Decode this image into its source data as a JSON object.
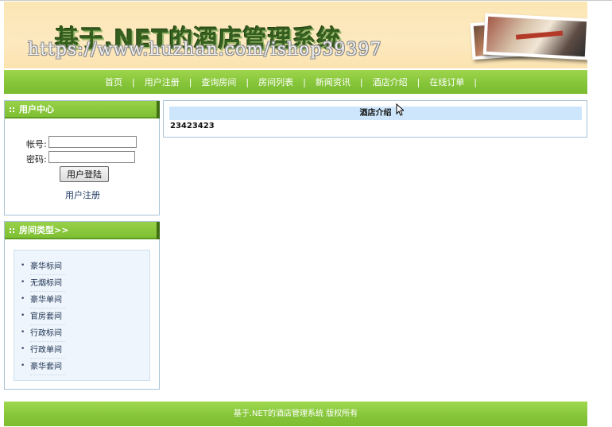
{
  "header": {
    "title": "基于.NET的酒店管理系统",
    "watermark": "https://www.huzhan.com/ishop39397"
  },
  "nav": {
    "items": [
      {
        "label": "首页"
      },
      {
        "label": "用户注册"
      },
      {
        "label": "查询房间"
      },
      {
        "label": "房间列表"
      },
      {
        "label": "新闻资讯"
      },
      {
        "label": "酒店介绍"
      },
      {
        "label": "在线订单"
      }
    ],
    "separator": "|"
  },
  "login": {
    "heading": "用户中心",
    "account_label": "帐号:",
    "password_label": "密码:",
    "account_value": "",
    "password_value": "",
    "login_button": "用户登陆",
    "register_link": "用户注册"
  },
  "rooms": {
    "heading": "房间类型>>",
    "items": [
      {
        "label": "豪华标间"
      },
      {
        "label": "无烟标间"
      },
      {
        "label": "豪华单间"
      },
      {
        "label": "官房套间"
      },
      {
        "label": "行政标间"
      },
      {
        "label": "行政单间"
      },
      {
        "label": "豪华套间"
      }
    ]
  },
  "main": {
    "heading": "酒店介绍",
    "content": "23423423"
  },
  "footer": {
    "text": "基于.NET的酒店管理系统 版权所有"
  },
  "colors": {
    "nav_green": "#86c53a",
    "banner_bg": "#fde9bf",
    "title_green": "#355f1e",
    "table_head_blue": "#cde6fb",
    "border_blue": "#a8c3d8"
  }
}
